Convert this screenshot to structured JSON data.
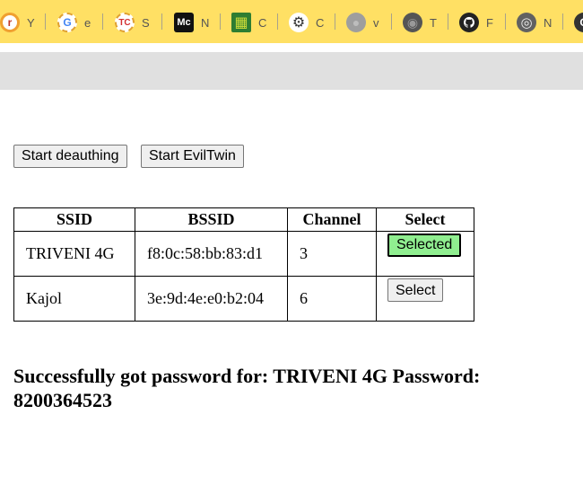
{
  "bookmarks": [
    {
      "icon": "r",
      "letter": "Y",
      "name": "bookmark-r-icon"
    },
    {
      "icon": "G",
      "letter": "e",
      "name": "google-icon"
    },
    {
      "icon": "TC",
      "letter": "S",
      "name": "tc-icon"
    },
    {
      "icon": "Mc",
      "letter": "N",
      "name": "mc-icon"
    },
    {
      "icon": "▦",
      "letter": "C",
      "name": "qr-icon"
    },
    {
      "icon": "⚙",
      "letter": "C",
      "name": "openai-icon"
    },
    {
      "icon": "●",
      "letter": "v",
      "name": "globe-icon"
    },
    {
      "icon": "◉",
      "letter": "T",
      "name": "globe-dark-icon"
    },
    {
      "icon": "🐱",
      "letter": "F",
      "name": "github-icon"
    },
    {
      "icon": "◎",
      "letter": "N",
      "name": "chrome-icon"
    },
    {
      "icon": "G",
      "letter": "",
      "name": "bookmark-edge-icon"
    }
  ],
  "toolbar": {
    "deauth_label": "Start deauthing",
    "eviltwin_label": "Start EvilTwin"
  },
  "table": {
    "headers": {
      "ssid": "SSID",
      "bssid": "BSSID",
      "channel": "Channel",
      "select": "Select"
    },
    "rows": [
      {
        "ssid": "TRIVENI 4G",
        "bssid": "f8:0c:58:bb:83:d1",
        "channel": "3",
        "button": "Selected",
        "selected": true
      },
      {
        "ssid": "Kajol",
        "bssid": "3e:9d:4e:e0:b2:04",
        "channel": "6",
        "button": "Select",
        "selected": false
      }
    ]
  },
  "result": {
    "message": "Successfully got password for: TRIVENI 4G Password: 8200364523"
  },
  "colors": {
    "tabstrip": "#ffe064",
    "selected_button": "#90ee90",
    "grey_bar": "#e0e0e0"
  }
}
